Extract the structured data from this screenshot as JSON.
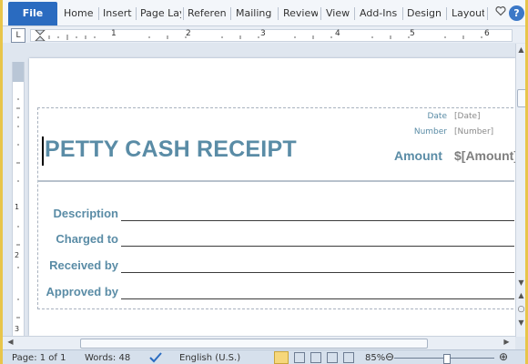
{
  "ribbon": {
    "file": "File",
    "tabs": [
      "Home",
      "Insert",
      "Page Lay",
      "Referen",
      "Mailing",
      "Review",
      "View",
      "Add-Ins",
      "Design",
      "Layout"
    ],
    "help": "?"
  },
  "ruler": {
    "tab_selector": "L",
    "h_numbers": [
      "1",
      "2",
      "3",
      "4",
      "5",
      "6"
    ],
    "v_numbers": [
      "1",
      "2",
      "3"
    ]
  },
  "receipt": {
    "title": "PETTY CASH RECEIPT",
    "date_label": "Date",
    "date_value": "[Date]",
    "number_label": "Number",
    "number_value": "[Number]",
    "amount_label": "Amount",
    "amount_value": "$[Amount]",
    "fields": [
      "Description",
      "Charged to",
      "Received by",
      "Approved by"
    ]
  },
  "status": {
    "page": "Page: 1 of 1",
    "words": "Words: 48",
    "language": "English (U.S.)",
    "zoom": "85%"
  }
}
